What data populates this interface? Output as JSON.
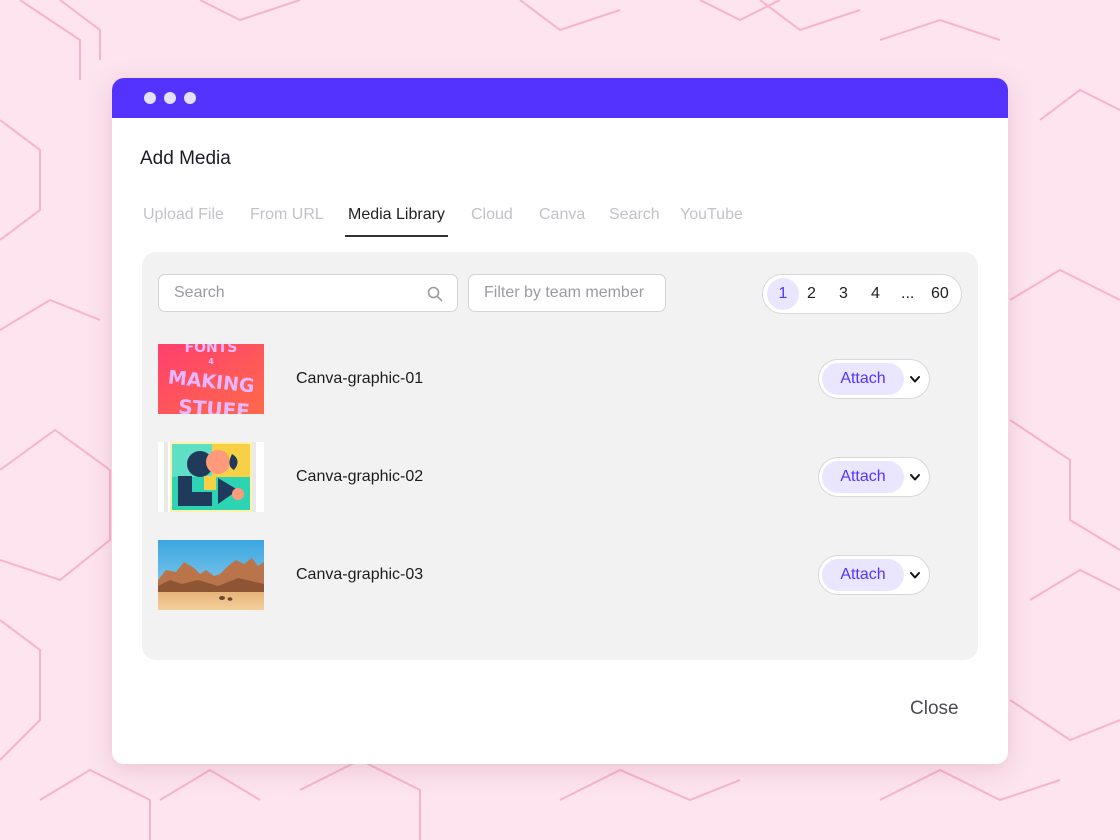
{
  "dialog": {
    "title": "Add Media",
    "close_label": "Close"
  },
  "tabs": [
    {
      "label": "Upload File",
      "active": false
    },
    {
      "label": "From URL",
      "active": false
    },
    {
      "label": "Media Library",
      "active": true
    },
    {
      "label": "Cloud",
      "active": false
    },
    {
      "label": "Canva",
      "active": false
    },
    {
      "label": "Search",
      "active": false
    },
    {
      "label": "YouTube",
      "active": false
    }
  ],
  "search": {
    "placeholder": "Search",
    "value": ""
  },
  "filter": {
    "placeholder": "Filter by team member",
    "value": ""
  },
  "pagination": {
    "pages": [
      "1",
      "2",
      "3",
      "4",
      "...",
      "60"
    ],
    "current": "1"
  },
  "files": [
    {
      "name": "Canva-graphic-01",
      "action": "Attach",
      "thumbnail_text": [
        "FONTS",
        "4",
        "MAKING",
        "STUFF"
      ]
    },
    {
      "name": "Canva-graphic-02",
      "action": "Attach"
    },
    {
      "name": "Canva-graphic-03",
      "action": "Attach"
    }
  ],
  "colors": {
    "accent": "#5533ff",
    "accent_light": "#ebe6ff",
    "background": "#fde4ee",
    "panel": "#f2f2f2"
  },
  "icons": {
    "search": "search-icon",
    "dropdown": "chevron-down-icon",
    "window_controls": "window-dot-icon"
  }
}
